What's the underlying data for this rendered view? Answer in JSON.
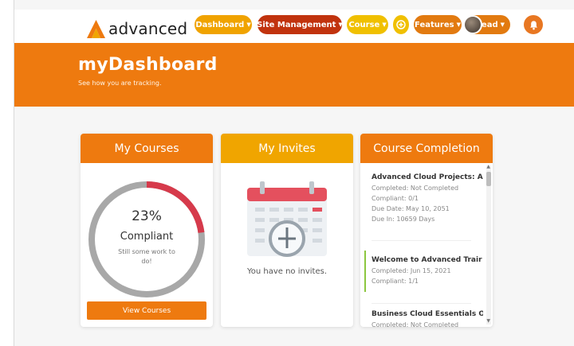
{
  "nav": {
    "brand": "advanced",
    "items": [
      {
        "label": "Dashboard"
      },
      {
        "label": "Site Management"
      },
      {
        "label": "Course"
      },
      {
        "label": "Features"
      },
      {
        "label": "Lead"
      }
    ],
    "plus_icon": "plus-circle-icon",
    "bell_icon": "bell-icon"
  },
  "banner": {
    "title": "myDashboard",
    "subtitle": "See how you are tracking."
  },
  "my_courses": {
    "header": "My Courses",
    "percent": "23%",
    "status": "Compliant",
    "note": "Still some work to do!",
    "progress": 0.23,
    "button": "View Courses"
  },
  "my_invites": {
    "header": "My Invites",
    "empty_text": "You have no invites."
  },
  "course_completion": {
    "header": "Course Completion",
    "items": [
      {
        "title": "Advanced Cloud Projects: Ac",
        "lines": [
          "Completed: Not Completed",
          "Compliant: 0/1",
          "Due Date: May 10, 2051",
          "Due In: 10659 Days"
        ]
      },
      {
        "title": "Welcome to Advanced Trair",
        "lines": [
          "Completed: Jun 15, 2021",
          "Compliant: 1/1"
        ]
      },
      {
        "title": "Business Cloud Essentials Or",
        "lines": [
          "Completed: Not Completed"
        ]
      }
    ]
  },
  "colors": {
    "primary": "#ee7a0f",
    "amber": "#f0a500",
    "red": "#d63a4b",
    "grey": "#a8a8a8",
    "green": "#8cc63f"
  }
}
